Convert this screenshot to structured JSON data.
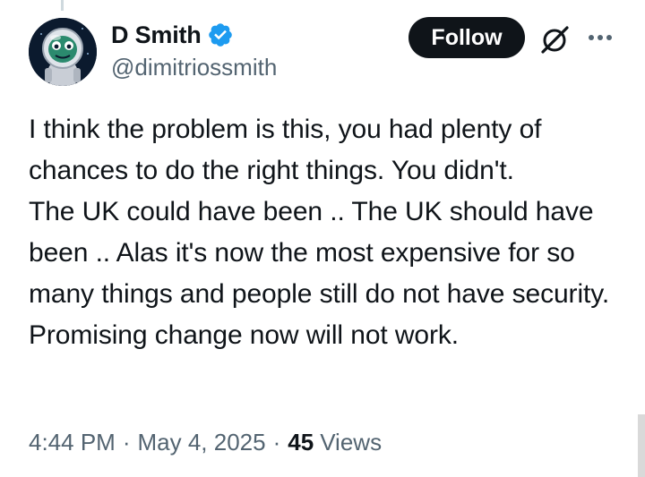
{
  "author": {
    "display_name": "D Smith",
    "handle": "@dimitriossmith",
    "verified": true
  },
  "actions": {
    "follow_label": "Follow"
  },
  "tweet": {
    "text": "I think the problem is this, you had plenty of chances to do the right things. You didn't.\nThe UK could have been .. The UK should have been .. Alas it's now the most expensive for so many things and people still do not have security.\nPromising change now will not work."
  },
  "meta": {
    "time": "4:44 PM",
    "separator": "·",
    "date": "May 4, 2025",
    "views_count": "45",
    "views_label": "Views"
  },
  "icons": {
    "verified": "verified-badge-icon",
    "grok": "grok-icon",
    "more": "more-options-icon"
  },
  "colors": {
    "text_primary": "#0f1419",
    "text_secondary": "#536471",
    "verified_blue": "#1d9bf0",
    "follow_bg": "#0f1419",
    "follow_text": "#ffffff"
  }
}
